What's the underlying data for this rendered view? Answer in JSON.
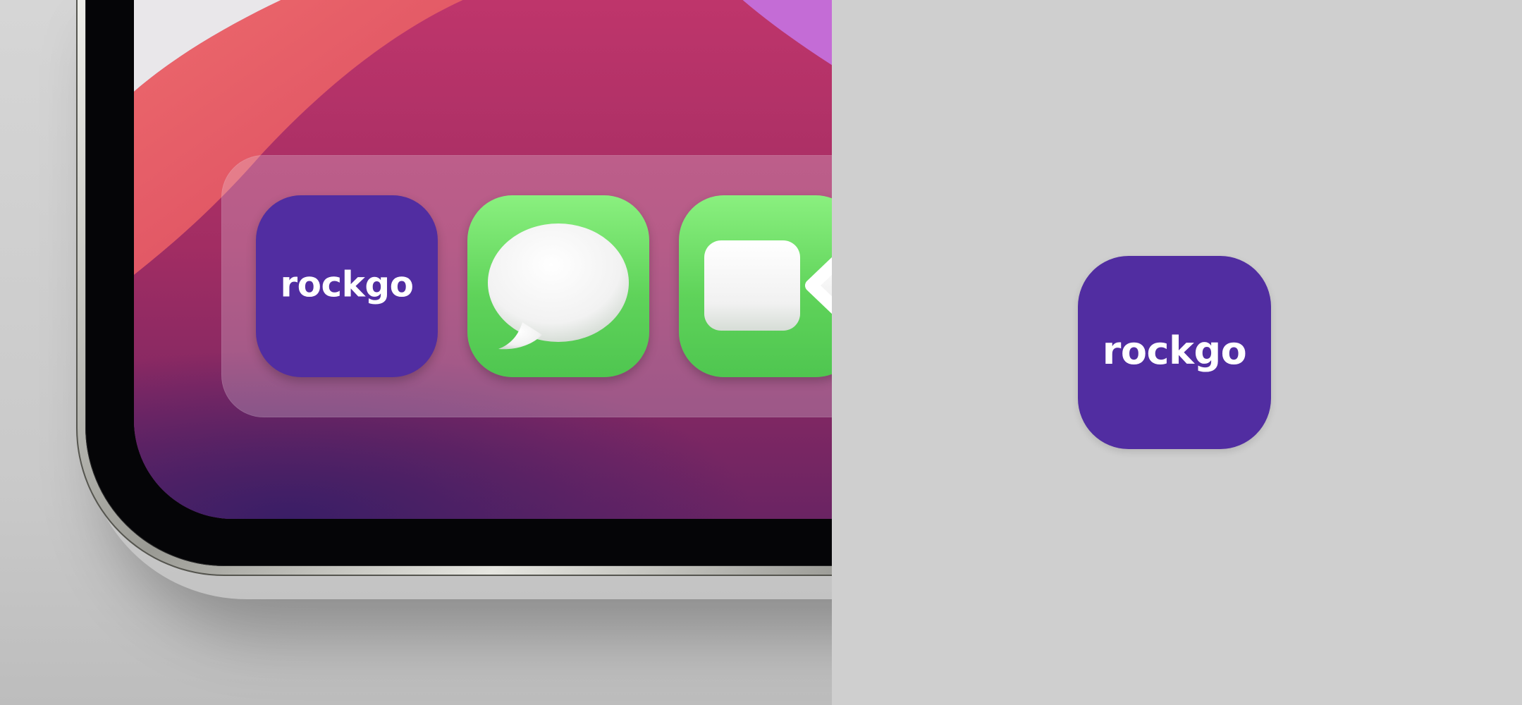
{
  "dock_apps": [
    {
      "name": "rockgo",
      "label": "rockgo",
      "color": "#512da1"
    },
    {
      "name": "messages",
      "color": "#5fd35a"
    },
    {
      "name": "facetime",
      "color": "#5fd35a"
    }
  ],
  "standalone_icon": {
    "label": "rockgo",
    "color": "#512da1"
  },
  "colors": {
    "panel_background": "#cfcfcf",
    "brand_purple": "#512da1",
    "icon_green": "#5fd35a",
    "wallpaper_magenta": "#b42f68",
    "wallpaper_coral": "#e75c6a",
    "wallpaper_lavender": "#c46cd6"
  }
}
